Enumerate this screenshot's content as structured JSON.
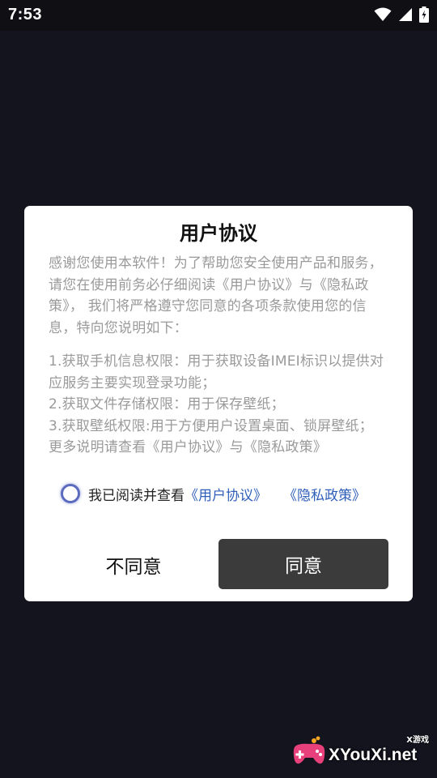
{
  "status_bar": {
    "time": "7:53",
    "icons": [
      "wifi-icon",
      "cellular-signal-icon",
      "battery-charging-icon"
    ]
  },
  "dialog": {
    "title": "用户协议",
    "intro": "感谢您使用本软件！为了帮助您安全使用产品和服务，请您在使用前务必仔细阅读《用户协议》与《隐私政策》， 我们将严格遵守您同意的各项条款使用您的信息，特向您说明如下：",
    "items": [
      "1.获取手机信息权限：用于获取设备IMEI标识以提供对应服务主要实现登录功能；",
      "2.获取文件存储权限：用于保存壁纸；",
      "3.获取壁纸权限:用于方便用户设置桌面、锁屏壁纸；",
      "更多说明请查看《用户协议》与《隐私政策》"
    ],
    "agree_checkbox": {
      "label": "我已阅读并查看",
      "link_user_agreement": "《用户协议》",
      "link_privacy_policy": "《隐私政策》",
      "checked": false
    },
    "disagree_label": "不同意",
    "agree_label": "同意"
  },
  "watermark": {
    "site": "XYouXi.net",
    "tag": "X游戏"
  },
  "colors": {
    "background": "#14141f",
    "dialog": "#ffffff",
    "body_text": "#9a9a9a",
    "link": "#2f5fb8",
    "agree_button": "#3b3b3b",
    "radio": "#5c6bc0"
  }
}
